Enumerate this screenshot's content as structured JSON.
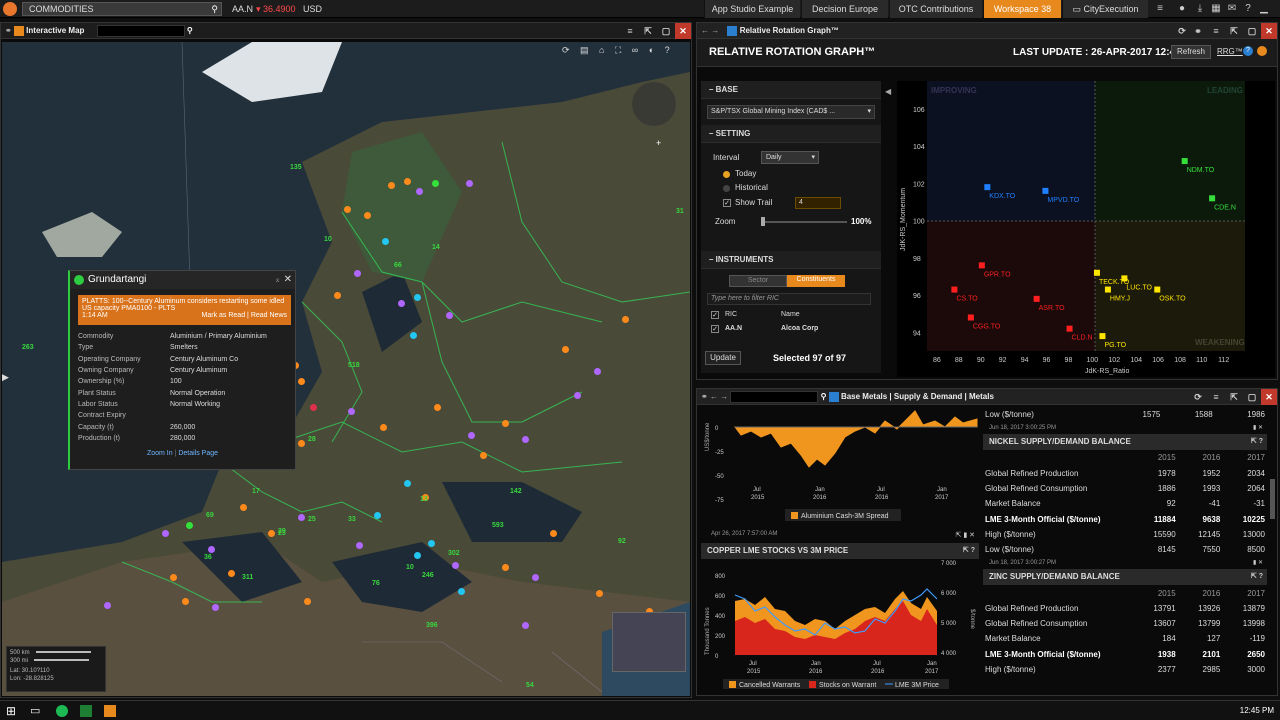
{
  "topbar": {
    "search_value": "COMMODITIES",
    "ticker_symbol": "AA.N",
    "ticker_price": "▾ 36.4900",
    "ticker_currency": "USD",
    "tabs": [
      "App Studio Example",
      "Decision Europe",
      "OTC Contributions",
      "Workspace 38",
      "CityExecution"
    ],
    "active_tab": "Workspace 38"
  },
  "map_panel": {
    "title": "Interactive Map",
    "popup": {
      "title": "Grundartangi",
      "news": "PLATTS: 100--Century Aluminum considers restarting some idled US capacity  PMA0100  - PLTS",
      "news_time": "1:14 AM",
      "mark_read": "Mark as Read",
      "read_news": "Read News",
      "fields": [
        {
          "k": "Commodity",
          "v": "Aluminium / Primary Aluminium"
        },
        {
          "k": "Type",
          "v": "Smelters"
        },
        {
          "k": "Operating Company",
          "v": "Century Aluminum Co"
        },
        {
          "k": "Owning Company",
          "v": "Century Aluminum"
        },
        {
          "k": "Ownership (%)",
          "v": "100"
        },
        {
          "k": "Plant Status",
          "v": "Normal Operation"
        },
        {
          "k": "Labor Status",
          "v": "Normal Working"
        },
        {
          "k": "Contract Expiry",
          "v": ""
        },
        {
          "k": "Capacity (t)",
          "v": "260,000"
        },
        {
          "k": "Production (t)",
          "v": "280,000"
        }
      ],
      "zoom_in": "Zoom In",
      "details_page": "Details Page"
    },
    "scale": {
      "km": "500 km",
      "mi": "300 mi",
      "lat": "Lat:  30.10?110",
      "lon": "Lon:  -28.828125"
    },
    "labels": [
      "135",
      "31",
      "10",
      "14",
      "66",
      "263",
      "518",
      "69",
      "33",
      "17",
      "25",
      "23",
      "311",
      "36",
      "142",
      "92",
      "593",
      "396",
      "302",
      "246",
      "76",
      "10",
      "54",
      "408",
      "13",
      "28",
      "29"
    ]
  },
  "rrg": {
    "window_title": "Relative Rotation Graph™",
    "title": "RELATIVE ROTATION GRAPH™",
    "last_update": "LAST UPDATE : 26-APR-2017 12:45",
    "refresh": "Refresh",
    "rrg_link": "RRG™",
    "base_label": "BASE",
    "base_value": "S&P/TSX Global Mining Index (CAD$ ...",
    "setting_label": "SETTING",
    "interval_label": "Interval",
    "interval_value": "Daily",
    "today": "Today",
    "historical": "Historical",
    "show_trail": "Show Trail",
    "trail_value": "4",
    "zoom_label": "Zoom",
    "zoom_value": "100%",
    "instruments_label": "INSTRUMENTS",
    "sector_tab": "Sector",
    "constituents_tab": "Constituents",
    "filter_placeholder": "Type here to filter RIC",
    "col_ric": "RIC",
    "col_name": "Name",
    "row_ric": "AA.N",
    "row_name": "Alcoa Corp",
    "update_btn": "Update",
    "selected": "Selected 97 of 97",
    "quadrants": {
      "improving": "IMPROVING",
      "leading": "LEADING",
      "weakening": "WEAKENING"
    },
    "y_axis_label": "JdK-RS_Momentum",
    "x_axis_label": "JdK-RS_Ratio",
    "y_ticks": [
      "106",
      "104",
      "102",
      "100",
      "98",
      "96",
      "94"
    ],
    "x_ticks": [
      "86",
      "88",
      "90",
      "92",
      "94",
      "96",
      "98",
      "100",
      "102",
      "104",
      "106",
      "108",
      "110",
      "112"
    ],
    "points": [
      {
        "label": "KDX.TO",
        "x": 90.5,
        "y": 101.8,
        "color": "#1f7fff"
      },
      {
        "label": "MPVD.TO",
        "x": 95.8,
        "y": 101.6,
        "color": "#1f7fff"
      },
      {
        "label": "NDM.TO",
        "x": 108.5,
        "y": 103.2,
        "color": "#36e03a"
      },
      {
        "label": "CDE.N",
        "x": 111,
        "y": 101.2,
        "color": "#36e03a"
      },
      {
        "label": "GPR.TO",
        "x": 90,
        "y": 97.6,
        "color": "#ff1f1f"
      },
      {
        "label": "CS.TO",
        "x": 87.5,
        "y": 96.3,
        "color": "#ff1f1f"
      },
      {
        "label": "CGG.TO",
        "x": 89,
        "y": 94.8,
        "color": "#ff1f1f"
      },
      {
        "label": "ASR.TO",
        "x": 95,
        "y": 95.8,
        "color": "#ff1f1f"
      },
      {
        "label": "CLD.N",
        "x": 98,
        "y": 94.2,
        "color": "#ff1f1f"
      },
      {
        "label": "PG.TO",
        "x": 101,
        "y": 93.8,
        "color": "#ffe600"
      },
      {
        "label": "HMY.J",
        "x": 101.5,
        "y": 96.3,
        "color": "#ffe600"
      },
      {
        "label": "OSK.TO",
        "x": 106,
        "y": 96.3,
        "color": "#ffe600"
      },
      {
        "label": "TECK.TO",
        "x": 100.5,
        "y": 97.2,
        "color": "#ffe600"
      },
      {
        "label": "LUC.TO",
        "x": 103,
        "y": 96.9,
        "color": "#ffe600"
      }
    ]
  },
  "base_metals": {
    "title": "Base Metals | Supply & Demand | Metals",
    "aluminium_chart": {
      "y_label": "US$/tonne",
      "y_ticks": [
        "0",
        "-25",
        "-50",
        "-75"
      ],
      "x_ticks": [
        "Jul 2015",
        "Jan 2016",
        "Jul 2016",
        "Jan 2017"
      ],
      "legend": "Aluminium Cash-3M Spread",
      "timestamp": "Apr 26, 2017 7:57:00 AM"
    },
    "copper_chart": {
      "title": "COPPER LME STOCKS VS 3M PRICE",
      "y_left_label": "Thousand Tonnes",
      "y_right_label": "$/tonne",
      "y_left_ticks": [
        "0",
        "200",
        "400",
        "600",
        "800"
      ],
      "y_right_ticks": [
        "7 000",
        "6 000",
        "5 000",
        "4 000"
      ],
      "x_ticks": [
        "Jul 2015",
        "Jan 2016",
        "Jul 2016",
        "Jan 2017"
      ],
      "legend": [
        "Cancelled Warrants",
        "Stocks on Warrant",
        "LME 3M Price"
      ]
    },
    "top_row": {
      "label": "Low ($/tonne)",
      "v": [
        "1575",
        "1588",
        "1986"
      ]
    },
    "nickel": {
      "timestamp": "Jun 18, 2017 3:00:25 PM",
      "title": "NICKEL SUPPLY/DEMAND BALANCE",
      "years": [
        "2015",
        "2016",
        "2017"
      ],
      "rows": [
        {
          "label": "Global Refined Production",
          "v": [
            "1978",
            "1952",
            "2034"
          ]
        },
        {
          "label": "Global Refined Consumption",
          "v": [
            "1886",
            "1993",
            "2064"
          ]
        },
        {
          "label": "Market Balance",
          "v": [
            "92",
            "-41",
            "-31"
          ]
        },
        {
          "label": "LME 3-Month Official ($/tonne)",
          "v": [
            "11884",
            "9638",
            "10225"
          ],
          "bold": true
        },
        {
          "label": "High ($/tonne)",
          "v": [
            "15590",
            "12145",
            "13000"
          ]
        },
        {
          "label": "Low ($/tonne)",
          "v": [
            "8145",
            "7550",
            "8500"
          ]
        }
      ]
    },
    "zinc": {
      "timestamp": "Jun 18, 2017 3:00:27 PM",
      "title": "ZINC SUPPLY/DEMAND BALANCE",
      "years": [
        "2015",
        "2016",
        "2017"
      ],
      "rows": [
        {
          "label": "Global Refined Production",
          "v": [
            "13791",
            "13926",
            "13879"
          ]
        },
        {
          "label": "Global Refined Consumption",
          "v": [
            "13607",
            "13799",
            "13998"
          ]
        },
        {
          "label": "Market Balance",
          "v": [
            "184",
            "127",
            "-119"
          ]
        },
        {
          "label": "LME 3-Month Official ($/tonne)",
          "v": [
            "1938",
            "2101",
            "2650"
          ],
          "bold": true
        },
        {
          "label": "High ($/tonne)",
          "v": [
            "2377",
            "2985",
            "3000"
          ]
        }
      ]
    }
  },
  "taskbar": {
    "clock": "12:45 PM"
  }
}
